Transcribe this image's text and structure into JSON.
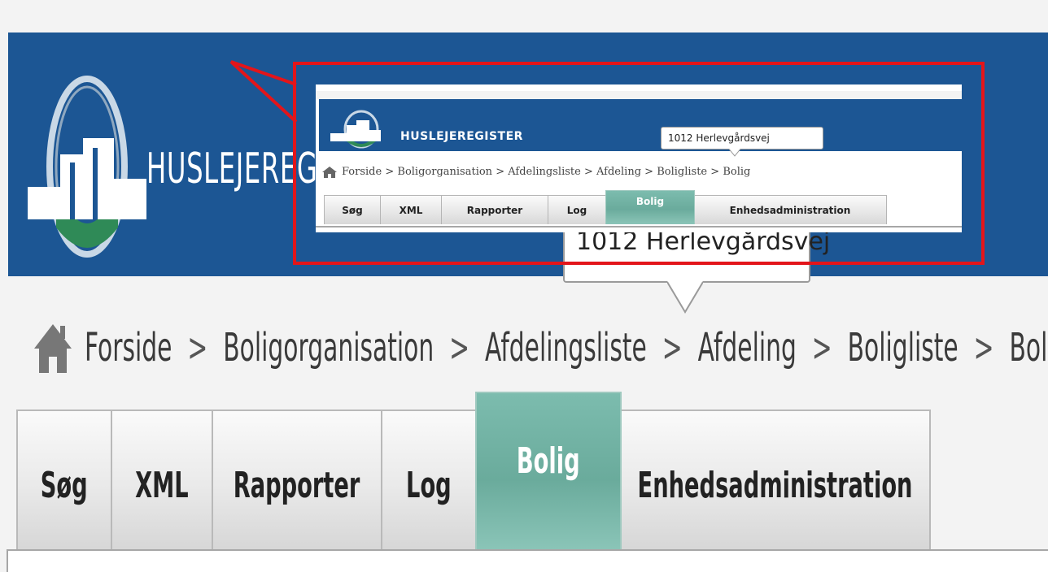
{
  "app": {
    "brand_name": "HUSLEJEREGISTER",
    "brand_colors": {
      "header_blue": "#1c5694",
      "active_tab": "#6aab9c",
      "callout_border": "#e3151a"
    }
  },
  "tooltip": {
    "text": "1012 Herlevgårdsvej"
  },
  "breadcrumb": {
    "home_icon": "home-icon",
    "items": [
      "Forside",
      "Boligorganisation",
      "Afdelingsliste",
      "Afdeling",
      "Boligliste",
      "Bolig"
    ],
    "separator": ">"
  },
  "tabs": [
    {
      "label": "Søg",
      "active": false
    },
    {
      "label": "XML",
      "active": false
    },
    {
      "label": "Rapporter",
      "active": false
    },
    {
      "label": "Log",
      "active": false
    },
    {
      "label": "Bolig",
      "active": true
    },
    {
      "label": "Enhedsadministration",
      "active": false
    }
  ]
}
